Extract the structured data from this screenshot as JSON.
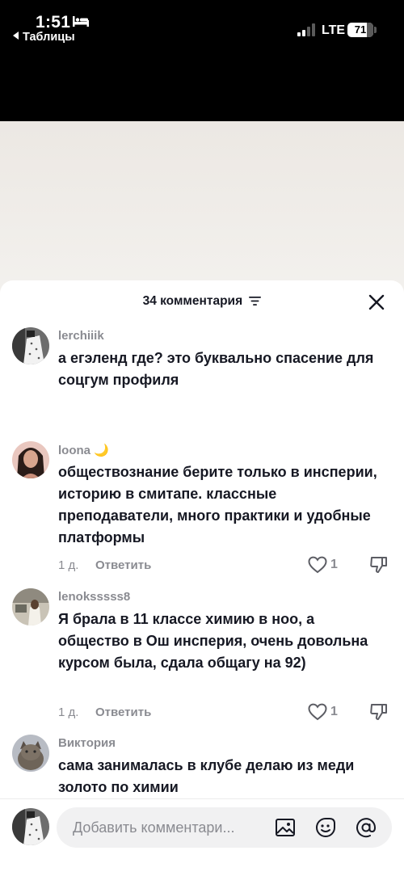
{
  "status_bar": {
    "time": "1:51",
    "back_app": "Таблицы",
    "network": "LTE",
    "battery": "71"
  },
  "sheet": {
    "title": "34 комментария"
  },
  "comments": [
    {
      "username": "lerchiiik",
      "text": "а егэленд где? это буквально спасение для соцгум профиля"
    },
    {
      "username": "loona 🌙",
      "text": "обществознание берите только в инсперии, историю в смитапе. классные преподаватели, много практики и удобные платформы",
      "age": "1 д.",
      "reply_label": "Ответить",
      "likes": "1"
    },
    {
      "username": "lenoksssss8",
      "text": "Я брала в 11 классе химию в ноо, а общество в Ош инсперия, очень довольна курсом была, сдала общагу на 92)",
      "age": "1 д.",
      "reply_label": "Ответить",
      "likes": "1"
    },
    {
      "username": "Виктория",
      "text": "сама занималась в клубе делаю из меди золото по химии"
    }
  ],
  "composer": {
    "placeholder": "Добавить комментари..."
  },
  "icons": {
    "sort": "sort-icon",
    "close": "close-icon",
    "like": "heart-icon",
    "dislike": "thumbs-down-icon",
    "image": "image-icon",
    "emoji": "emoji-icon",
    "mention": "at-icon"
  },
  "colors": {
    "text_primary": "#161823",
    "text_secondary": "#8a8b91",
    "input_bg": "#f1f1f2"
  }
}
